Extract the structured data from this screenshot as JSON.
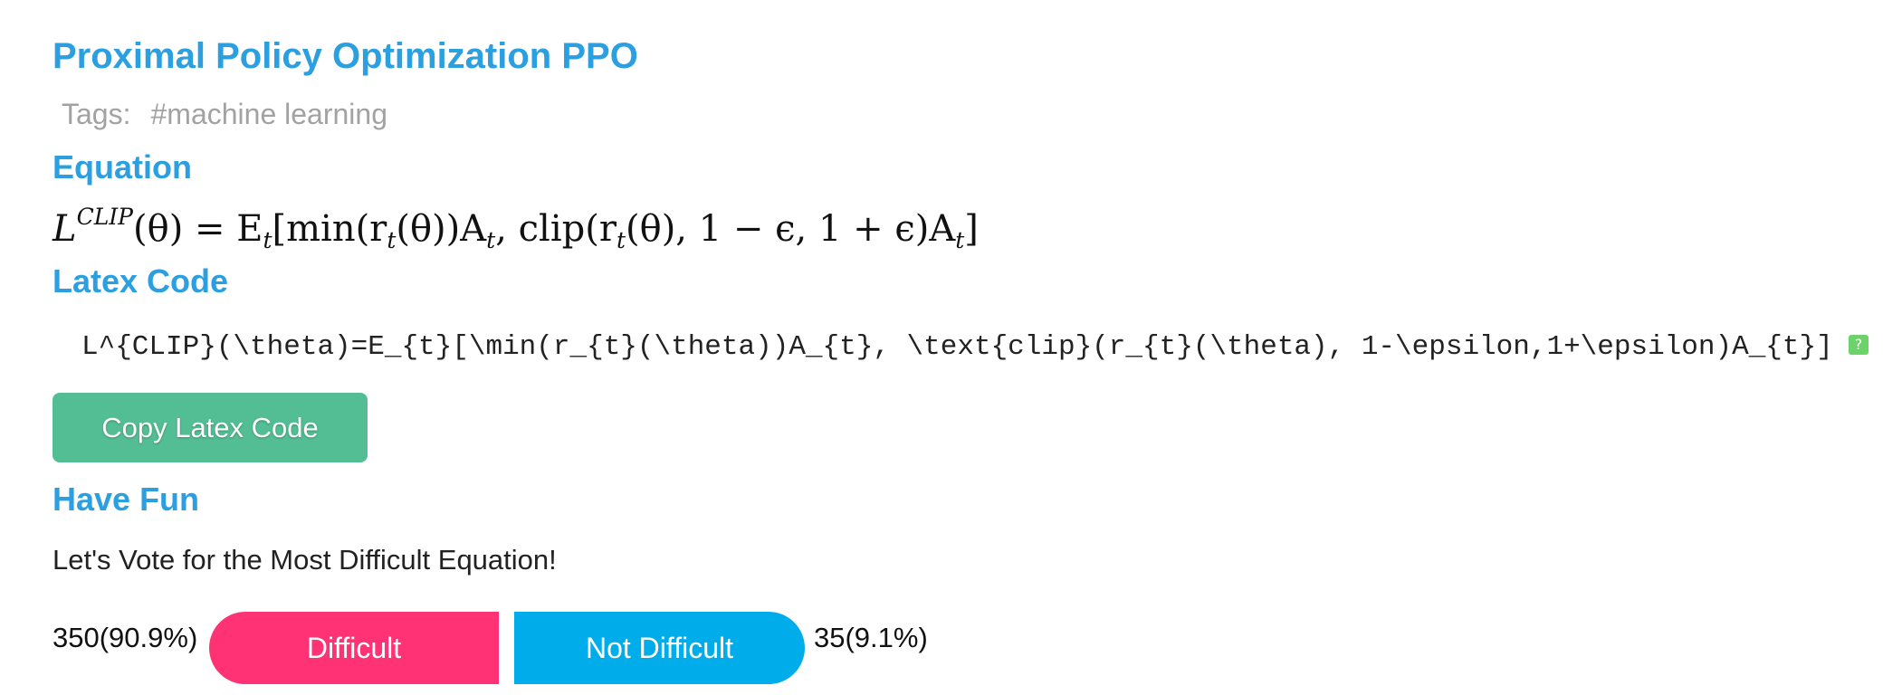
{
  "page": {
    "title": "Proximal Policy Optimization PPO",
    "tags_label": "Tags:",
    "tags": [
      "#machine learning"
    ]
  },
  "sections": {
    "equation_heading": "Equation",
    "latex_heading": "Latex Code",
    "fun_heading": "Have Fun"
  },
  "equation": {
    "rendered": {
      "lhs_base": "L",
      "lhs_sup": "CLIP",
      "lhs_arg": "(θ) = E",
      "expectation_sub": "t",
      "body_1": "[min(r",
      "body_1_sub": "t",
      "body_2": "(θ))A",
      "body_2_sub": "t",
      "body_3": ", clip(r",
      "body_3_sub": "t",
      "body_4": "(θ), 1 − ϵ, 1 + ϵ)A",
      "body_4_sub": "t",
      "body_5": "]"
    },
    "latex_code": "L^{CLIP}(\\theta)=E_{t}[\\min(r_{t}(\\theta))A_{t}, \\text{clip}(r_{t}(\\theta), 1-\\epsilon,1+\\epsilon)A_{t}]",
    "help_badge": "?"
  },
  "actions": {
    "copy_label": "Copy Latex Code"
  },
  "vote": {
    "prompt": "Let's Vote for the Most Difficult Equation!",
    "difficult_count": "350(90.9%)",
    "difficult_label": "Difficult",
    "not_difficult_label": "Not Difficult",
    "not_difficult_count": "35(9.1%)",
    "difficult_color": "#fe3274",
    "not_difficult_color": "#00acea"
  },
  "colors": {
    "heading": "#2b9fe0",
    "tags": "#a2a2a2",
    "copy_button": "#53bd93"
  }
}
